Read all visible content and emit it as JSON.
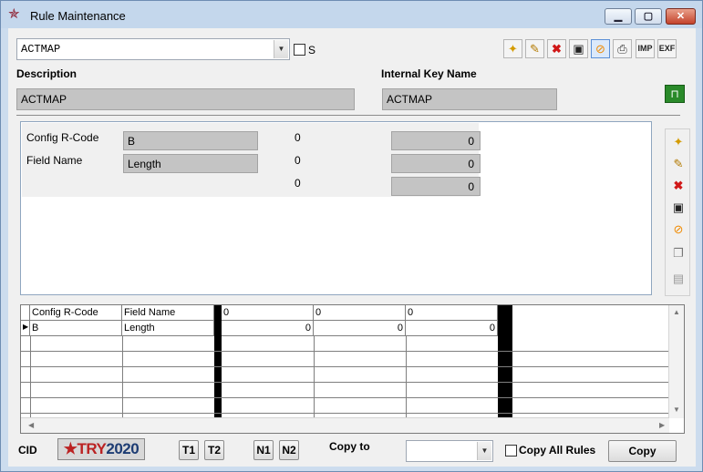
{
  "window": {
    "title": "Rule Maintenance"
  },
  "header": {
    "rule_select": "ACTMAP",
    "s_label": "S",
    "description_label": "Description",
    "description_value": "ACTMAP",
    "internal_key_label": "Internal Key Name",
    "internal_key_value": "ACTMAP"
  },
  "toolbar": {
    "buttons": [
      "new",
      "edit",
      "delete",
      "save",
      "cancel",
      "print"
    ],
    "imp_label": "IMP",
    "exf_label": "EXF"
  },
  "form": {
    "config_rcode_label": "Config R-Code",
    "config_rcode_value": "B",
    "field_name_label": "Field Name",
    "field_name_value": "Length",
    "zero_labels": [
      "0",
      "0",
      "0"
    ],
    "number_fields": [
      "0",
      "0",
      "0"
    ]
  },
  "grid": {
    "columns": [
      "Config R-Code",
      "Field Name",
      "0",
      "0",
      "0"
    ],
    "rows": [
      {
        "config": "B",
        "field": "Length",
        "v1": "0",
        "v2": "0",
        "v3": "0"
      }
    ]
  },
  "footer": {
    "cid_label": "CID",
    "logo_text_a": "TRY",
    "logo_text_b": "2020",
    "t1": "T1",
    "t2": "T2",
    "n1": "N1",
    "n2": "N2",
    "copy_to_label": "Copy to",
    "copy_to_value": "",
    "copy_all_label": "Copy All Rules",
    "copy_button": "Copy"
  },
  "colors": {
    "title_bg": "#c4d7ec",
    "field_bg": "#c4c4c4",
    "close_red": "#c4432c"
  }
}
